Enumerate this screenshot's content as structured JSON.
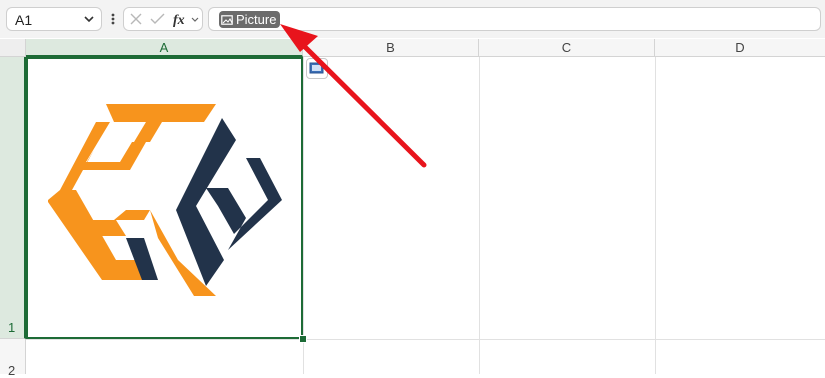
{
  "namebox": {
    "value": "A1"
  },
  "formula": {
    "chip_label": "Picture"
  },
  "columns": [
    {
      "label": "A",
      "selected": true
    },
    {
      "label": "B",
      "selected": false
    },
    {
      "label": "C",
      "selected": false
    },
    {
      "label": "D",
      "selected": false
    }
  ],
  "rows": [
    {
      "label": "1",
      "selected": true
    },
    {
      "label": "2",
      "selected": false
    }
  ],
  "colors": {
    "selection": "#1d6b36",
    "logo_orange": "#f7941d",
    "logo_navy": "#22334a",
    "annotation_arrow": "#e8141c"
  }
}
